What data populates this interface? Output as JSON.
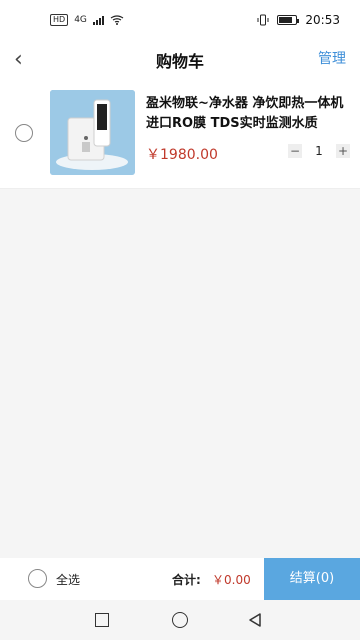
{
  "status": {
    "hd": "HD",
    "net": "4G",
    "time": "20:53",
    "icons": [
      "signal-icon",
      "wifi-icon",
      "vibrate-icon",
      "battery-icon"
    ]
  },
  "nav": {
    "back": "‹",
    "title": "购物车",
    "manage": "管理"
  },
  "cart": {
    "items": [
      {
        "name": "盈米物联~净水器 净饮即热一体机 进口RO膜 TDS实时监测水质",
        "price": "￥1980.00",
        "minus": "−",
        "qty": "1",
        "plus": "+"
      }
    ]
  },
  "footer": {
    "select_all": "全选",
    "total_label": "合计:",
    "total_value": "￥0.00",
    "checkout": "结算(0)"
  },
  "colors": {
    "accent": "#3f8fd8",
    "checkout_bg": "#5aa7e0",
    "price": "#c0392b"
  }
}
